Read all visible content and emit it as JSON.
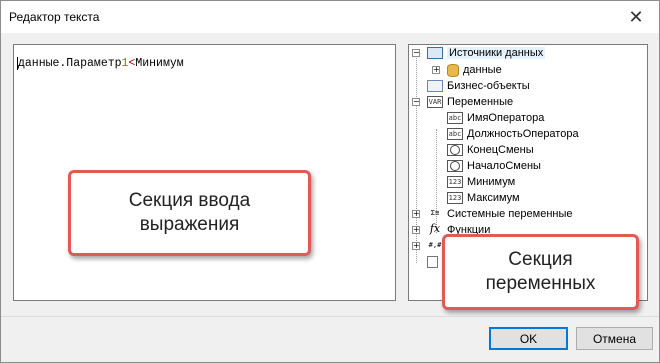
{
  "window": {
    "title": "Редактор текста",
    "close_glyph": "✕"
  },
  "editor": {
    "expression_prefix": "данные.Параметр",
    "expression_num": "1",
    "expression_op": "<",
    "expression_suffix": "Минимум"
  },
  "tree": {
    "data_sources": {
      "label": "Источники данных",
      "icon": "table-icon"
    },
    "data": {
      "label": "данные",
      "icon": "database-icon"
    },
    "business_objects": {
      "label": "Бизнес-объекты",
      "icon": "business-object-icon"
    },
    "variables": {
      "label": "Переменные",
      "icon": "var-icon",
      "icon_text": "VAR"
    },
    "variable_items": [
      {
        "label": "ИмяОператора",
        "icon_text": "abc"
      },
      {
        "label": "ДолжностьОператора",
        "icon_text": "abc"
      },
      {
        "label": "КонецСмены",
        "icon_text": ""
      },
      {
        "label": "НачалоСмены",
        "icon_text": ""
      },
      {
        "label": "Минимум",
        "icon_text": "123"
      },
      {
        "label": "Максимум",
        "icon_text": "123"
      }
    ],
    "system_variables": {
      "label": "Системные переменные",
      "icon_text": "Σ≡"
    },
    "functions": {
      "label": "Функции",
      "icon_text": "fx"
    },
    "more_icon_text": "#,#"
  },
  "callouts": {
    "expression_section": "Секция ввода\nвыражения",
    "variables_section": "Секция\nпеременных"
  },
  "buttons": {
    "ok": "OK",
    "cancel": "Отмена"
  },
  "colors": {
    "callout_border": "#e05a5a",
    "default_button_border": "#0078d7"
  }
}
